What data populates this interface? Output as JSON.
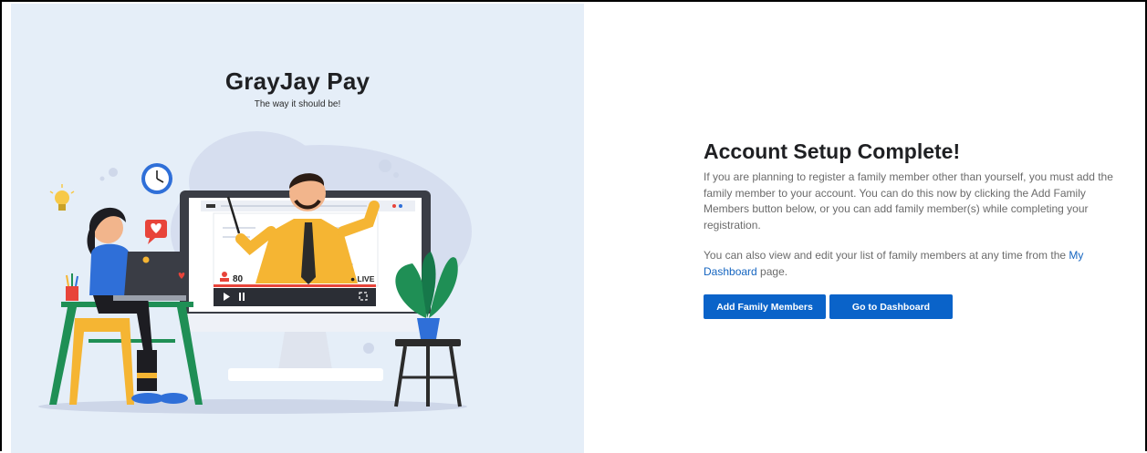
{
  "brand": {
    "title": "GrayJay Pay",
    "tagline": "The way it should be!"
  },
  "illustration": {
    "viewer_count": "80",
    "live_label": "● LIVE",
    "icons": [
      "clock-icon",
      "lightbulb-icon",
      "heart-message-icon",
      "play-icon",
      "pause-icon",
      "fullscreen-icon",
      "person-icon"
    ]
  },
  "setup": {
    "title": "Account Setup Complete!",
    "paragraph1": "If you are planning to register a family member other than yourself, you must add the family member to your account. You can do this now by clicking the Add Family Members button below, or you can add family member(s) while completing your registration.",
    "paragraph2_before": "You can also view and edit your list of family members at any time from the ",
    "paragraph2_link": "My Dashboard",
    "paragraph2_after": " page.",
    "add_button": "Add Family Members",
    "dashboard_button": "Go to Dashboard"
  },
  "colors": {
    "left_background": "#e5eef8",
    "button": "#0a63c9",
    "link": "#1565c0",
    "title": "#1f2023",
    "body_text": "#6b6b6b"
  }
}
